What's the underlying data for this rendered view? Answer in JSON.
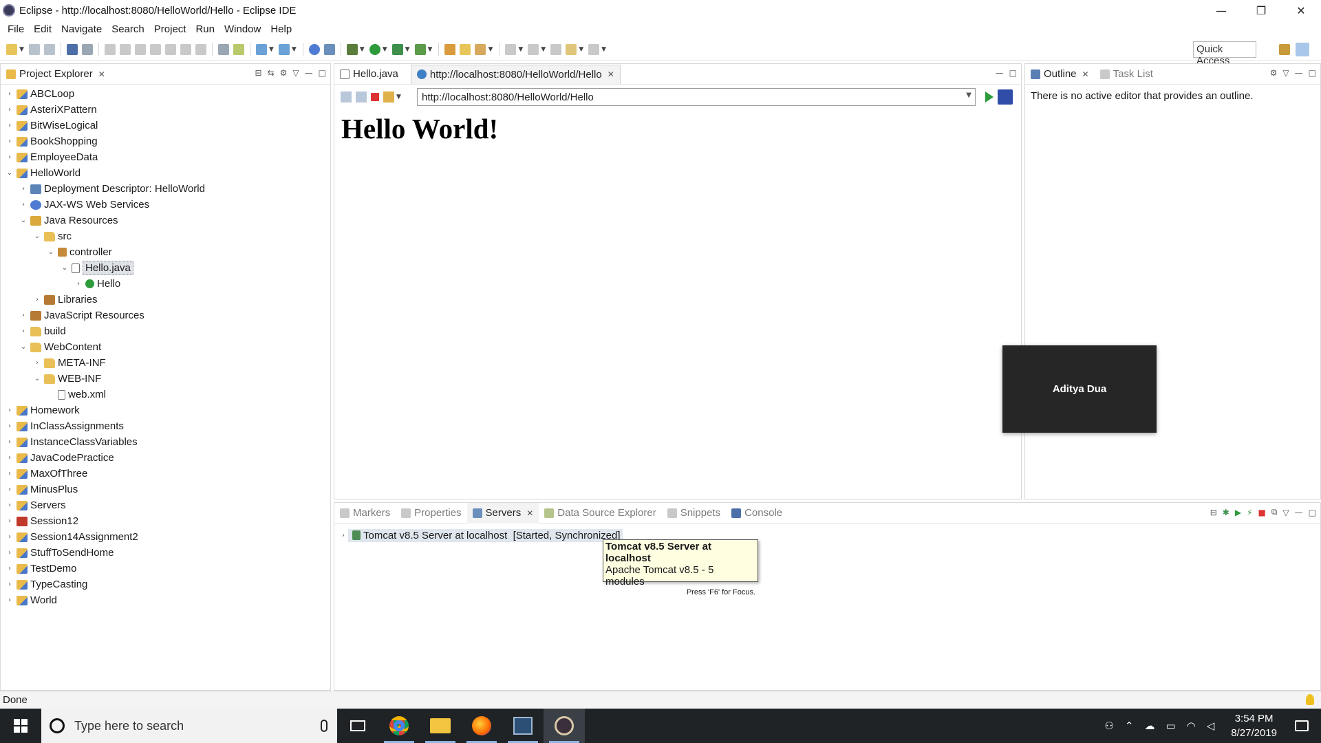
{
  "window": {
    "title": "Eclipse - http://localhost:8080/HelloWorld/Hello - Eclipse IDE",
    "controls": {
      "minimize": "—",
      "maximize": "❐",
      "close": "✕"
    }
  },
  "menu": [
    "File",
    "Edit",
    "Navigate",
    "Search",
    "Project",
    "Run",
    "Window",
    "Help"
  ],
  "toolbar": {
    "quick_access": "Quick Access"
  },
  "project_explorer": {
    "tab_label": "Project Explorer",
    "tree": [
      {
        "label": "ABCLoop",
        "depth": 0,
        "expanded": false,
        "icon": "project-icon"
      },
      {
        "label": "AsteriXPattern",
        "depth": 0,
        "expanded": false,
        "icon": "project-icon"
      },
      {
        "label": "BitWiseLogical",
        "depth": 0,
        "expanded": false,
        "icon": "project-icon"
      },
      {
        "label": "BookShopping",
        "depth": 0,
        "expanded": false,
        "icon": "project-icon"
      },
      {
        "label": "EmployeeData",
        "depth": 0,
        "expanded": false,
        "icon": "project-icon"
      },
      {
        "label": "HelloWorld",
        "depth": 0,
        "expanded": true,
        "icon": "project-icon"
      },
      {
        "label": "Deployment Descriptor: HelloWorld",
        "depth": 1,
        "expanded": false,
        "icon": "deployment-descriptor-icon"
      },
      {
        "label": "JAX-WS Web Services",
        "depth": 1,
        "expanded": false,
        "icon": "web-services-icon"
      },
      {
        "label": "Java Resources",
        "depth": 1,
        "expanded": true,
        "icon": "java-resources-icon"
      },
      {
        "label": "src",
        "depth": 2,
        "expanded": true,
        "icon": "source-folder-icon"
      },
      {
        "label": "controller",
        "depth": 3,
        "expanded": true,
        "icon": "package-icon"
      },
      {
        "label": "Hello.java",
        "depth": 4,
        "expanded": true,
        "icon": "java-file-icon",
        "selected": true
      },
      {
        "label": "Hello",
        "depth": 5,
        "expanded": false,
        "icon": "class-icon"
      },
      {
        "label": "Libraries",
        "depth": 2,
        "expanded": false,
        "icon": "libraries-icon"
      },
      {
        "label": "JavaScript Resources",
        "depth": 1,
        "expanded": false,
        "icon": "javascript-resources-icon"
      },
      {
        "label": "build",
        "depth": 1,
        "expanded": false,
        "icon": "folder-icon"
      },
      {
        "label": "WebContent",
        "depth": 1,
        "expanded": true,
        "icon": "folder-icon"
      },
      {
        "label": "META-INF",
        "depth": 2,
        "expanded": false,
        "icon": "folder-icon"
      },
      {
        "label": "WEB-INF",
        "depth": 2,
        "expanded": true,
        "icon": "folder-icon"
      },
      {
        "label": "web.xml",
        "depth": 3,
        "expanded": null,
        "icon": "xml-file-icon"
      },
      {
        "label": "Homework",
        "depth": 0,
        "expanded": false,
        "icon": "project-icon"
      },
      {
        "label": "InClassAssignments",
        "depth": 0,
        "expanded": false,
        "icon": "project-icon"
      },
      {
        "label": "InstanceClassVariables",
        "depth": 0,
        "expanded": false,
        "icon": "project-icon"
      },
      {
        "label": "JavaCodePractice",
        "depth": 0,
        "expanded": false,
        "icon": "project-icon"
      },
      {
        "label": "MaxOfThree",
        "depth": 0,
        "expanded": false,
        "icon": "project-icon"
      },
      {
        "label": "MinusPlus",
        "depth": 0,
        "expanded": false,
        "icon": "project-icon"
      },
      {
        "label": "Servers",
        "depth": 0,
        "expanded": false,
        "icon": "project-icon"
      },
      {
        "label": "Session12",
        "depth": 0,
        "expanded": false,
        "icon": "server-project-icon"
      },
      {
        "label": "Session14Assignment2",
        "depth": 0,
        "expanded": false,
        "icon": "project-icon"
      },
      {
        "label": "StuffToSendHome",
        "depth": 0,
        "expanded": false,
        "icon": "project-icon"
      },
      {
        "label": "TestDemo",
        "depth": 0,
        "expanded": false,
        "icon": "project-icon"
      },
      {
        "label": "TypeCasting",
        "depth": 0,
        "expanded": false,
        "icon": "project-icon"
      },
      {
        "label": "World",
        "depth": 0,
        "expanded": false,
        "icon": "project-icon"
      }
    ]
  },
  "editor": {
    "tabs": [
      {
        "label": "Hello.java",
        "active": false
      },
      {
        "label": "http://localhost:8080/HelloWorld/Hello",
        "active": true
      }
    ],
    "url": "http://localhost:8080/HelloWorld/Hello",
    "page_heading": "Hello World!"
  },
  "outline": {
    "tabs": [
      {
        "label": "Outline",
        "active": true
      },
      {
        "label": "Task List",
        "active": false
      }
    ],
    "message": "There is no active editor that provides an outline."
  },
  "overlay": {
    "name": "Aditya Dua"
  },
  "bottom_panel": {
    "tabs": [
      {
        "label": "Markers",
        "active": false
      },
      {
        "label": "Properties",
        "active": false
      },
      {
        "label": "Servers",
        "active": true
      },
      {
        "label": "Data Source Explorer",
        "active": false
      },
      {
        "label": "Snippets",
        "active": false
      },
      {
        "label": "Console",
        "active": false
      }
    ],
    "server_entry": "Tomcat v8.5 Server at localhost  [Started, Synchronized]",
    "tooltip": {
      "title": "Tomcat v8.5 Server at localhost",
      "detail": "Apache Tomcat v8.5 - 5 modules",
      "hint": "Press 'F6' for Focus."
    }
  },
  "status": {
    "text": "Done"
  },
  "taskbar": {
    "search_placeholder": "Type here to search",
    "apps": [
      "chrome-icon",
      "file-explorer-icon",
      "firefox-icon",
      "eclipse-icon",
      "settings-icon"
    ],
    "time": "3:54 PM",
    "date": "8/27/2019"
  },
  "colors": {
    "taskbar_bg": "#1f2326",
    "selection": "#dfe3e8",
    "tooltip_bg": "#fffee1",
    "overlay_bg": "#262626",
    "run_green": "#2d9b3a"
  }
}
